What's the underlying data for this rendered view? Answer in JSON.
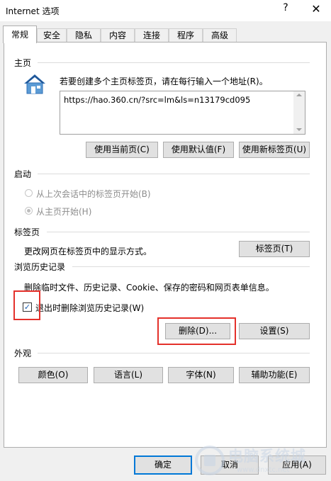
{
  "window": {
    "title": "Internet 选项",
    "help_glyph": "?",
    "close_glyph": "✕"
  },
  "tabs": [
    {
      "label": "常规",
      "active": true
    },
    {
      "label": "安全"
    },
    {
      "label": "隐私"
    },
    {
      "label": "内容"
    },
    {
      "label": "连接"
    },
    {
      "label": "程序"
    },
    {
      "label": "高级"
    }
  ],
  "homepage": {
    "section_label": "主页",
    "icon": "house-icon",
    "instruction": "若要创建多个主页标签页，请在每行输入一个地址(R)。",
    "url_value": "https://hao.360.cn/?src=lm&ls=n13179cd095",
    "btn_current": "使用当前页(C)",
    "btn_default": "使用默认值(F)",
    "btn_newtab": "使用新标签页(U)"
  },
  "startup": {
    "section_label": "启动",
    "option_last_session": "从上次会话中的标签页开始(B)",
    "option_homepage": "从主页开始(H)",
    "selected": "option_homepage"
  },
  "tabs_section": {
    "section_label": "标签页",
    "description": "更改网页在标签页中的显示方式。",
    "button": "标签页(T)"
  },
  "history": {
    "section_label": "浏览历史记录",
    "description": "删除临时文件、历史记录、Cookie、保存的密码和网页表单信息。",
    "checkbox_label": "退出时删除浏览历史记录(W)",
    "checkbox_checked": true,
    "btn_delete": "删除(D)...",
    "btn_settings": "设置(S)"
  },
  "appearance": {
    "section_label": "外观",
    "btn_colors": "颜色(O)",
    "btn_languages": "语言(L)",
    "btn_fonts": "字体(N)",
    "btn_accessibility": "辅助功能(E)"
  },
  "footer": {
    "ok": "确定",
    "cancel": "取消",
    "apply": "应用(A)"
  },
  "watermark": {
    "text": "电脑系统城",
    "subtext": "www.dnxtc.net"
  },
  "colors": {
    "highlight_red": "#e4312b",
    "accent_blue": "#0078d7",
    "house_blue": "#2f6fb5"
  }
}
